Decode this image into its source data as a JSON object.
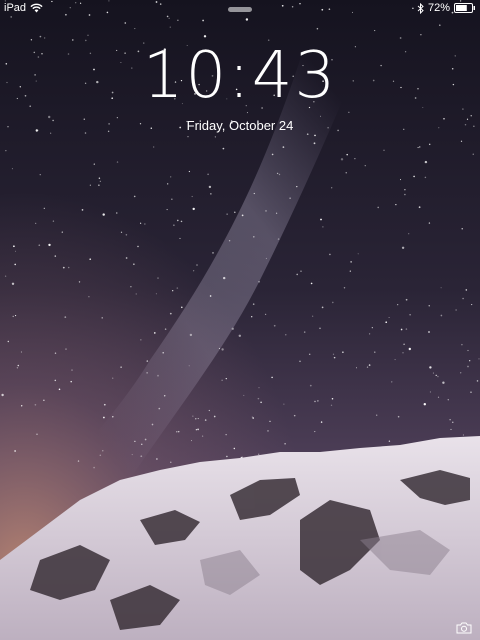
{
  "status_bar": {
    "device": "iPad",
    "wifi_icon": "wifi-icon",
    "bluetooth_icon": "bluetooth-icon",
    "battery_percent": "72%",
    "battery_level": 0.72
  },
  "lock_screen": {
    "time": "10:43",
    "date": "Friday, October 24"
  },
  "icons": {
    "camera": "camera-icon",
    "grabber": "notification-grabber"
  }
}
